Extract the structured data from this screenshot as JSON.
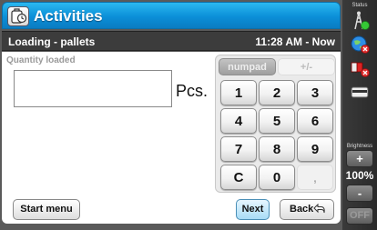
{
  "window": {
    "title": "Activities",
    "icon": "activities-icon"
  },
  "subheader": {
    "left": "Loading - pallets",
    "right": "11:28 AM - Now"
  },
  "form": {
    "quantity_label": "Quantity loaded",
    "quantity_value": "",
    "unit": "Pcs."
  },
  "keypad": {
    "tabs": [
      "numpad",
      "+/-"
    ],
    "keys": [
      "1",
      "2",
      "3",
      "4",
      "5",
      "6",
      "7",
      "8",
      "9",
      "C",
      "0",
      ","
    ]
  },
  "buttons": {
    "start_menu": "Start menu",
    "next": "Next",
    "back": "Back"
  },
  "side": {
    "status_label": "Status",
    "brightness_label": "Brightness",
    "brightness_value": "100%",
    "plus": "+",
    "minus": "-",
    "off": "OFF",
    "icons": [
      "antenna-status-icon",
      "globe-status-icon",
      "truck-status-icon",
      "card-reader-icon"
    ]
  },
  "colors": {
    "title_blue": "#0b8fd8",
    "next_blue": "#a8dcf6"
  }
}
